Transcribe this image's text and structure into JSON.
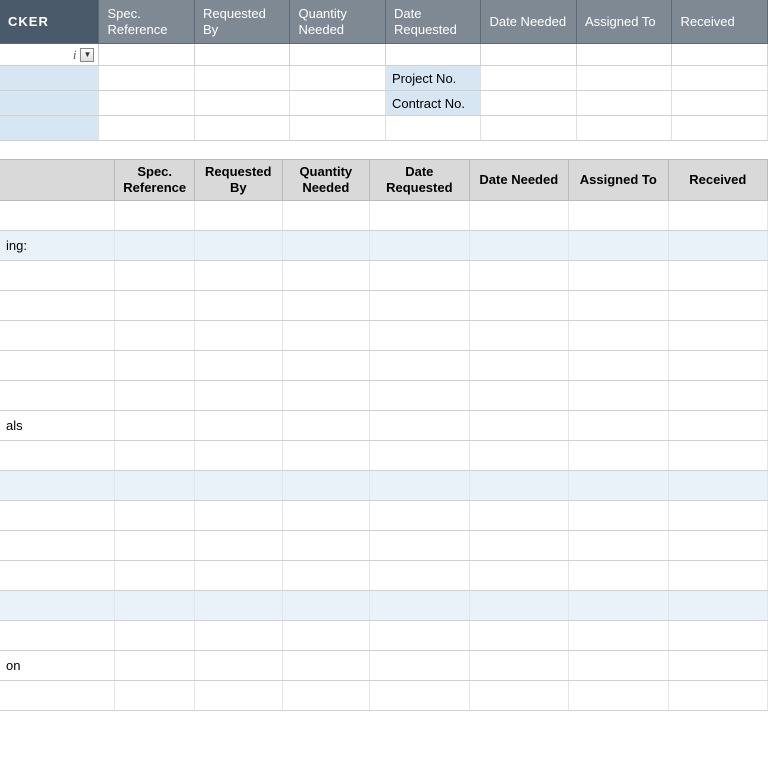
{
  "top_header": {
    "title_fragment": "CKER",
    "cols": [
      "Spec. Reference",
      "Requested By",
      "Quantity Needed",
      "Date Requested",
      "Date Needed",
      "Assigned To",
      "Received"
    ]
  },
  "filter": {
    "label": "i"
  },
  "meta_labels": {
    "project_no": "Project No.",
    "contract_no": "Contract No."
  },
  "second_header": {
    "cols": [
      "Spec. Reference",
      "Requested By",
      "Quantity Needed",
      "Date Requested",
      "Date Needed",
      "Assigned To",
      "Received"
    ]
  },
  "body": {
    "row_ing": "ing:",
    "row_als": "als",
    "row_on": "on"
  }
}
